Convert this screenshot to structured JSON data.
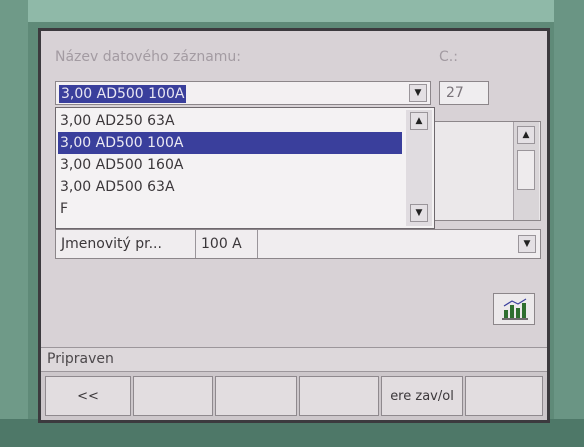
{
  "header": {
    "record_name_label": "Název datového záznamu:",
    "c_label": "C.:"
  },
  "combo": {
    "selected": "3,00 AD500 100A"
  },
  "c_box": {
    "value": "27"
  },
  "dropdown": {
    "items": [
      "3,00 AD250 63A",
      "3,00 AD500 100A",
      "3,00 AD500 160A",
      "3,00 AD500 63A",
      "F"
    ],
    "selected_index": 1
  },
  "param": {
    "name": "Jmenovitý pr...",
    "value": "100 A"
  },
  "status": {
    "text": "Pripraven"
  },
  "fkeys": {
    "back": "<<",
    "close": "ere zav/ol"
  },
  "icons": [
    "arrow-up-icon",
    "arrow-down-icon",
    "chart-icon"
  ]
}
